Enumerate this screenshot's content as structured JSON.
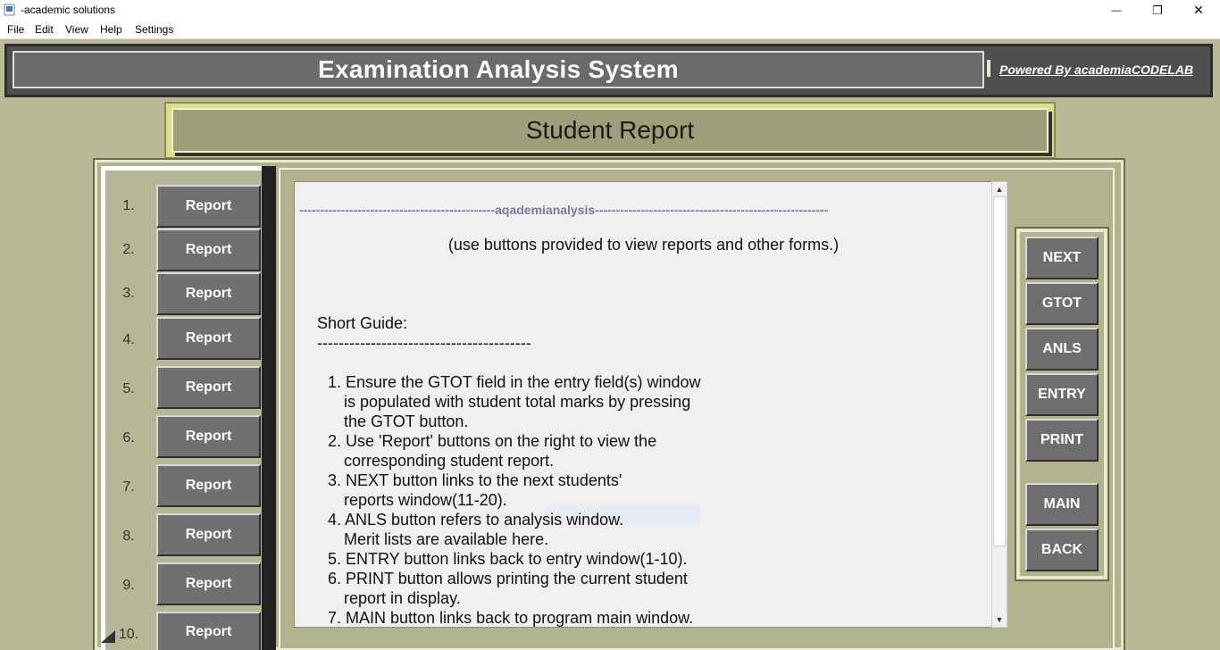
{
  "window": {
    "title": "-academic solutions",
    "minimize_glyph": "—",
    "restore_glyph": "❐",
    "close_glyph": "✕"
  },
  "menu": [
    "File",
    "Edit",
    "View",
    "Help",
    "Settings"
  ],
  "header": {
    "title": "Examination Analysis System",
    "powered_by": "Powered By academiaCODELAB"
  },
  "banner": {
    "title": "Student Report"
  },
  "reports": [
    {
      "num": "1.",
      "label": "Report"
    },
    {
      "num": "2.",
      "label": "Report"
    },
    {
      "num": "3.",
      "label": "Report"
    },
    {
      "num": "4.",
      "label": "Report"
    },
    {
      "num": "5.",
      "label": "Report"
    },
    {
      "num": "6.",
      "label": "Report"
    },
    {
      "num": "7.",
      "label": "Report"
    },
    {
      "num": "8.",
      "label": "Report"
    },
    {
      "num": "9.",
      "label": "Report"
    },
    {
      "num": "10.",
      "label": "Report"
    }
  ],
  "content": {
    "divider": "-----------------------------------------------aqademianalysis--------------------------------------------------------",
    "instruction": "(use buttons provided to view reports and other forms.)",
    "guide_title": "Short Guide:",
    "guide_underline": "----------------------------------------",
    "guide": [
      "1. Ensure the GTOT field in the entry field(s) window",
      "is populated with student total marks by pressing",
      "the GTOT button.",
      "2. Use 'Report' buttons on the right to view the",
      "corresponding student report.",
      "3. NEXT button links to the next students'",
      "reports window(11-20).",
      "4. ANLS button refers to analysis window.",
      "Merit lists are available here.",
      "5. ENTRY button links back to entry window(1-10).",
      "6. PRINT button allows printing the current student",
      "report in display.",
      "7. MAIN button links back to program main window."
    ]
  },
  "side_buttons": {
    "next": "NEXT",
    "gtot": "GTOT",
    "anls": "ANLS",
    "entry": "ENTRY",
    "print": "PRINT",
    "main": "MAIN",
    "back": "BACK"
  },
  "scroll": {
    "up_glyph": "▲",
    "down_glyph": "▼"
  },
  "colors": {
    "background": "#b9b996",
    "header_dark": "#4f4f4f",
    "banner": "#9e9e78",
    "button": "#707070",
    "divider_text": "#7a78a8"
  }
}
